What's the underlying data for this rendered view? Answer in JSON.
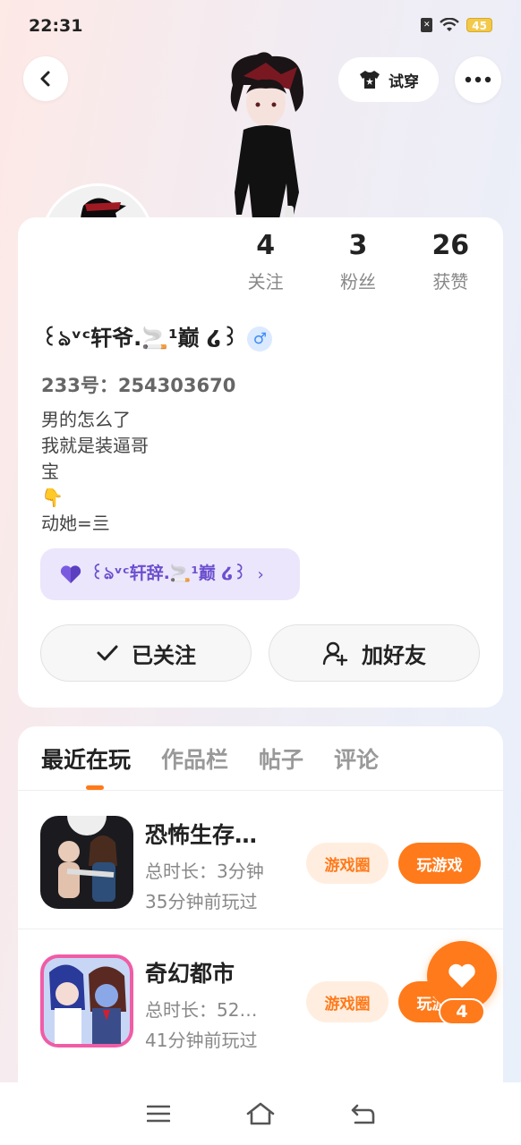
{
  "status_bar": {
    "time": "22:31",
    "battery": "45"
  },
  "header": {
    "tryon_label": "试穿"
  },
  "profile": {
    "stats": [
      {
        "value": "4",
        "label": "关注"
      },
      {
        "value": "3",
        "label": "粉丝"
      },
      {
        "value": "26",
        "label": "获赞"
      }
    ],
    "nickname": "꒰ঌᵛᶜ轩爷.🚬¹巅 ໒꒱",
    "gender": "♂",
    "uid": "233号：254303670",
    "bio": [
      "男的怎么了",
      "我就是装逼哥",
      "宝",
      "👇",
      "动她=亖"
    ],
    "cp_name": "꒰ঌᵛᶜ轩辞.🚬¹巅 ໒꒱",
    "follow_label": "已关注",
    "add_friend_label": "加好友"
  },
  "tabs": [
    {
      "label": "最近在玩"
    },
    {
      "label": "作品栏"
    },
    {
      "label": "帖子"
    },
    {
      "label": "评论"
    }
  ],
  "games": [
    {
      "title": "恐怖生存…",
      "duration": "总时长：3分钟",
      "last_played": "35分钟前玩过",
      "circle_label": "游戏圈",
      "play_label": "玩游戏"
    },
    {
      "title": "奇幻都市",
      "duration": "总时长：52…",
      "last_played": "41分钟前玩过",
      "circle_label": "游戏圈",
      "play_label": "玩游戏"
    }
  ],
  "like_fab": {
    "count": "4"
  },
  "colors": {
    "accent": "#ff7a1a",
    "cp_purple": "#6b4fcf",
    "gender_blue": "#3d8af7"
  }
}
